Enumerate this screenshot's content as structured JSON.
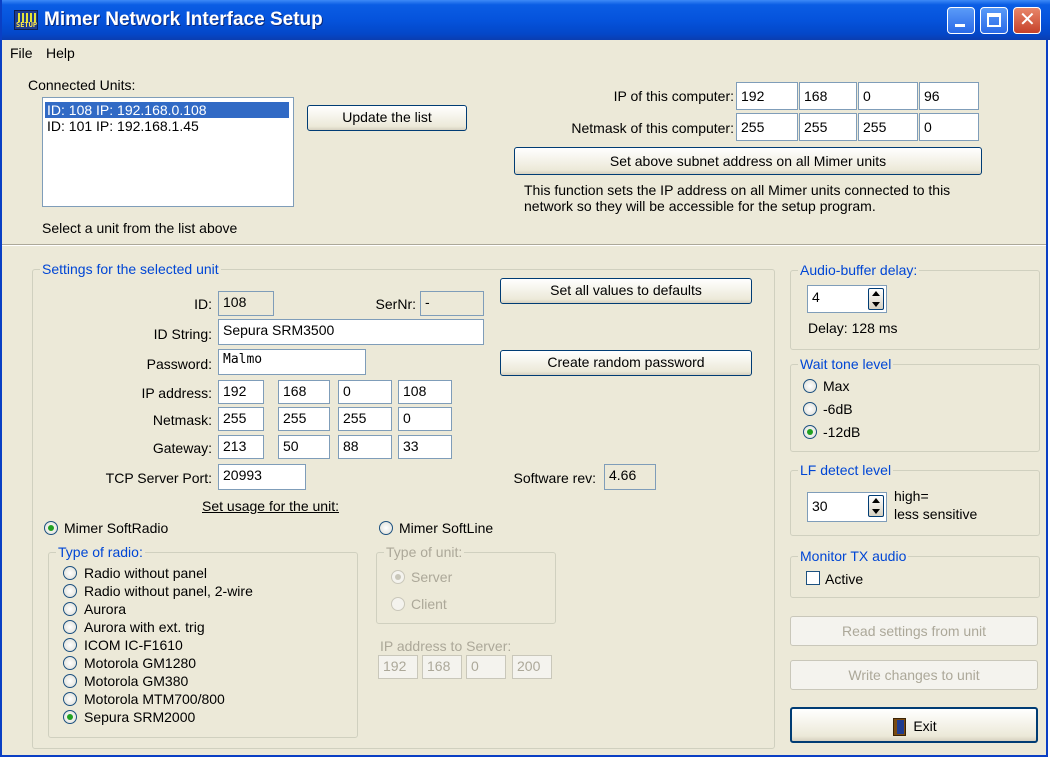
{
  "window": {
    "title": "Mimer Network Interface Setup",
    "icon_label": "SETUP",
    "accent_color": "#0a5de4",
    "group_title_color": "#0046d5"
  },
  "menu": [
    "File",
    "Help"
  ],
  "connected": {
    "label": "Connected Units:",
    "units": [
      "ID: 108  IP: 192.168.0.108",
      "ID: 101  IP: 192.168.1.45"
    ],
    "selected_index": 0,
    "hint": "Select a unit from the list above",
    "update_button": "Update the list"
  },
  "network": {
    "ip_label": "IP of this computer:",
    "ip": [
      "192",
      "168",
      "0",
      "96"
    ],
    "netmask_label": "Netmask of this computer:",
    "netmask": [
      "255",
      "255",
      "255",
      "0"
    ],
    "set_subnet_button": "Set above subnet address on all Mimer units",
    "note": "This function sets the IP address on all Mimer units connected to this network so they will be accessible for the setup program."
  },
  "settings": {
    "group_title": "Settings for the selected unit",
    "id_label": "ID:",
    "id": "108",
    "sernr_label": "SerNr:",
    "sernr": "-",
    "defaults_button": "Set all values to defaults",
    "id_string_label": "ID String:",
    "id_string": "Sepura SRM3500",
    "password_label": "Password:",
    "password": "Malmo",
    "random_password_button": "Create random password",
    "ip_label": "IP address:",
    "ip": [
      "192",
      "168",
      "0",
      "108"
    ],
    "netmask_label": "Netmask:",
    "netmask": [
      "255",
      "255",
      "255",
      "0"
    ],
    "gateway_label": "Gateway:",
    "gateway": [
      "213",
      "50",
      "88",
      "33"
    ],
    "tcp_port_label": "TCP Server Port:",
    "tcp_port": "20993",
    "software_rev_label": "Software rev:",
    "software_rev": "4.66",
    "usage_label": "Set usage for the unit:",
    "softradio_label": "Mimer SoftRadio",
    "softline_label": "Mimer SoftLine",
    "usage_selected": "softradio",
    "radio_type_title": "Type of radio:",
    "radio_types": [
      "Radio without panel",
      "Radio without panel, 2-wire",
      "Aurora",
      "Aurora with ext. trig",
      "ICOM IC-F1610",
      "Motorola GM1280",
      "Motorola GM380",
      "Motorola MTM700/800",
      "Sepura SRM2000"
    ],
    "radio_type_selected": 8,
    "unit_type_title": "Type of unit:",
    "unit_types": [
      "Server",
      "Client"
    ],
    "unit_type_selected": 0,
    "server_ip_label": "IP address to Server:",
    "server_ip": [
      "192",
      "168",
      "0",
      "200"
    ]
  },
  "audio": {
    "title": "Audio-buffer delay:",
    "value": "4",
    "delay_text": "Delay: 128 ms"
  },
  "wait_tone": {
    "title": "Wait tone level",
    "options": [
      "Max",
      "-6dB",
      "-12dB"
    ],
    "selected": 2
  },
  "lf_detect": {
    "title": "LF detect level",
    "value": "30",
    "hint_line1": "high=",
    "hint_line2": "less sensitive"
  },
  "monitor": {
    "title": "Monitor TX audio",
    "active_label": "Active",
    "checked": false
  },
  "actions": {
    "read_button": "Read settings from unit",
    "write_button": "Write changes to unit",
    "exit_button": "Exit"
  }
}
